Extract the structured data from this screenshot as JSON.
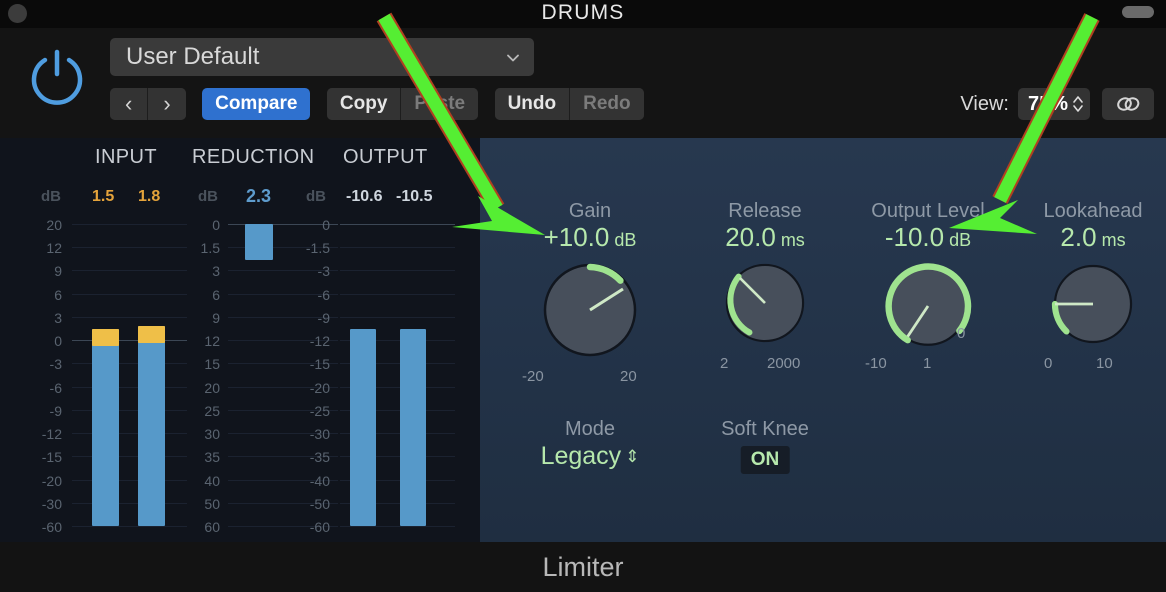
{
  "window": {
    "title": "DRUMS",
    "close_dot": "window-dot",
    "resize_pill": "window-pill"
  },
  "header": {
    "power_icon": "power-icon",
    "preset": {
      "value": "User Default",
      "chevron_icon": "chevron-down-icon"
    },
    "nav": {
      "prev": "‹",
      "next": "›"
    },
    "buttons": {
      "compare": "Compare",
      "copy": "Copy",
      "paste": "Paste",
      "undo": "Undo",
      "redo": "Redo"
    },
    "view": {
      "label": "View:",
      "value": "75%",
      "stepper_icon": "stepper-up-down-icon"
    },
    "link_icon": "link-chain-icon"
  },
  "meters": {
    "input": {
      "title": "INPUT",
      "db_tag": "dB",
      "readouts": [
        "1.5",
        "1.8"
      ],
      "ticks": [
        "20",
        "12",
        "9",
        "6",
        "3",
        "0",
        "-3",
        "-6",
        "-9",
        "-12",
        "-15",
        "-20",
        "-30",
        "-60"
      ],
      "bars": [
        {
          "level_db": 1.5,
          "peak_db": 1.5
        },
        {
          "level_db": 1.8,
          "peak_db": 1.8
        }
      ]
    },
    "reduction": {
      "title": "REDUCTION",
      "db_tag": "dB",
      "readouts": [
        "2.3"
      ],
      "ticks": [
        "0",
        "1.5",
        "3",
        "6",
        "9",
        "12",
        "15",
        "20",
        "25",
        "30",
        "35",
        "40",
        "50",
        "60"
      ],
      "bars": [
        {
          "level_db": 2.3
        }
      ]
    },
    "output": {
      "title": "OUTPUT",
      "db_tag": "dB",
      "readouts": [
        "-10.6",
        "-10.5"
      ],
      "ticks": [
        "0",
        "-1.5",
        "-3",
        "-6",
        "-9",
        "-12",
        "-15",
        "-20",
        "-25",
        "-30",
        "-35",
        "-40",
        "-50",
        "-60"
      ],
      "bars": [
        {
          "level_db": -10.6
        },
        {
          "level_db": -10.5
        }
      ]
    }
  },
  "controls": {
    "knobs": [
      {
        "name": "Gain",
        "value": "+10.0",
        "unit": "dB",
        "min_label": "-20",
        "max_label": "20",
        "extra_label": ""
      },
      {
        "name": "Release",
        "value": "20.0",
        "unit": "ms",
        "min_label": "2",
        "max_label": "2000",
        "extra_label": ""
      },
      {
        "name": "Output Level",
        "value": "-10.0",
        "unit": "dB",
        "min_label": "-10",
        "max_label": "1",
        "extra_label": "0"
      },
      {
        "name": "Lookahead",
        "value": "2.0",
        "unit": "ms",
        "min_label": "0",
        "max_label": "10",
        "extra_label": ""
      }
    ],
    "mode": {
      "name": "Mode",
      "value": "Legacy",
      "stepper_icon": "stepper-up-down-icon"
    },
    "soft_knee": {
      "name": "Soft Knee",
      "value": "ON"
    }
  },
  "footer": {
    "label": "Limiter"
  },
  "annotations": {
    "arrow_left": "green-arrow-pointing-to-gain",
    "arrow_right": "green-arrow-pointing-to-output-level",
    "arrow_color": "#55ee33"
  },
  "colors": {
    "accent_blue": "#2f71cf",
    "knob_green": "#b6e8ac",
    "meter_blue": "#5699c9",
    "meter_peak": "#efbf48",
    "panel_blue": "#233247",
    "arrow_green": "#55ee33"
  }
}
